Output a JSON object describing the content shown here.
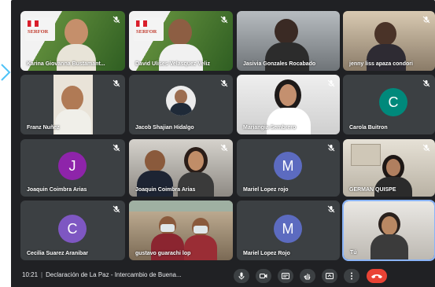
{
  "meeting": {
    "time": "10:21",
    "separator": "|",
    "title": "Declaración de La Paz - Intercambio de Buena..."
  },
  "logo_text": "SERFOR",
  "participants": [
    {
      "name": "Karina Giovanna Bustamant...",
      "kind": "video"
    },
    {
      "name": "David Ulises Velasquez Veliz",
      "kind": "video"
    },
    {
      "name": "Jasivia Gonzales Rocabado",
      "kind": "video"
    },
    {
      "name": "jenny liss apaza condori",
      "kind": "video"
    },
    {
      "name": "Franz Nuñez",
      "kind": "video"
    },
    {
      "name": "Jacob Shajian Hidalgo",
      "kind": "video"
    },
    {
      "name": "Mariangia Sembrero",
      "kind": "video"
    },
    {
      "name": "Carola Buitron",
      "kind": "avatar",
      "initial": "C",
      "color": "#00897b"
    },
    {
      "name": "Joaquin Coimbra Arias",
      "kind": "avatar",
      "initial": "J",
      "color": "#8e24aa"
    },
    {
      "name": "Joaquin Coimbra Arias",
      "kind": "video"
    },
    {
      "name": "Mariel Lopez rojo",
      "kind": "avatar",
      "initial": "M",
      "color": "#5c6bc0"
    },
    {
      "name": "GERMAN QUISPE",
      "kind": "video"
    },
    {
      "name": "Cecilia Suarez Aranibar",
      "kind": "avatar",
      "initial": "C",
      "color": "#7e57c2"
    },
    {
      "name": "gustavo guarachi lop",
      "kind": "video"
    },
    {
      "name": "Mariel Lopez Rojo",
      "kind": "avatar",
      "initial": "M",
      "color": "#5c6bc0"
    },
    {
      "name": "Tú",
      "kind": "video"
    }
  ],
  "colors": {
    "background": "#202124",
    "tile": "#3c4043",
    "end_call": "#ea4335",
    "accent": "#8ab4f8",
    "arrow": "#4fc3f7"
  },
  "controls": [
    "microphone-icon",
    "camera-icon",
    "captions-icon",
    "raise-hand-icon",
    "present-icon",
    "more-options-icon",
    "end-call-icon"
  ]
}
